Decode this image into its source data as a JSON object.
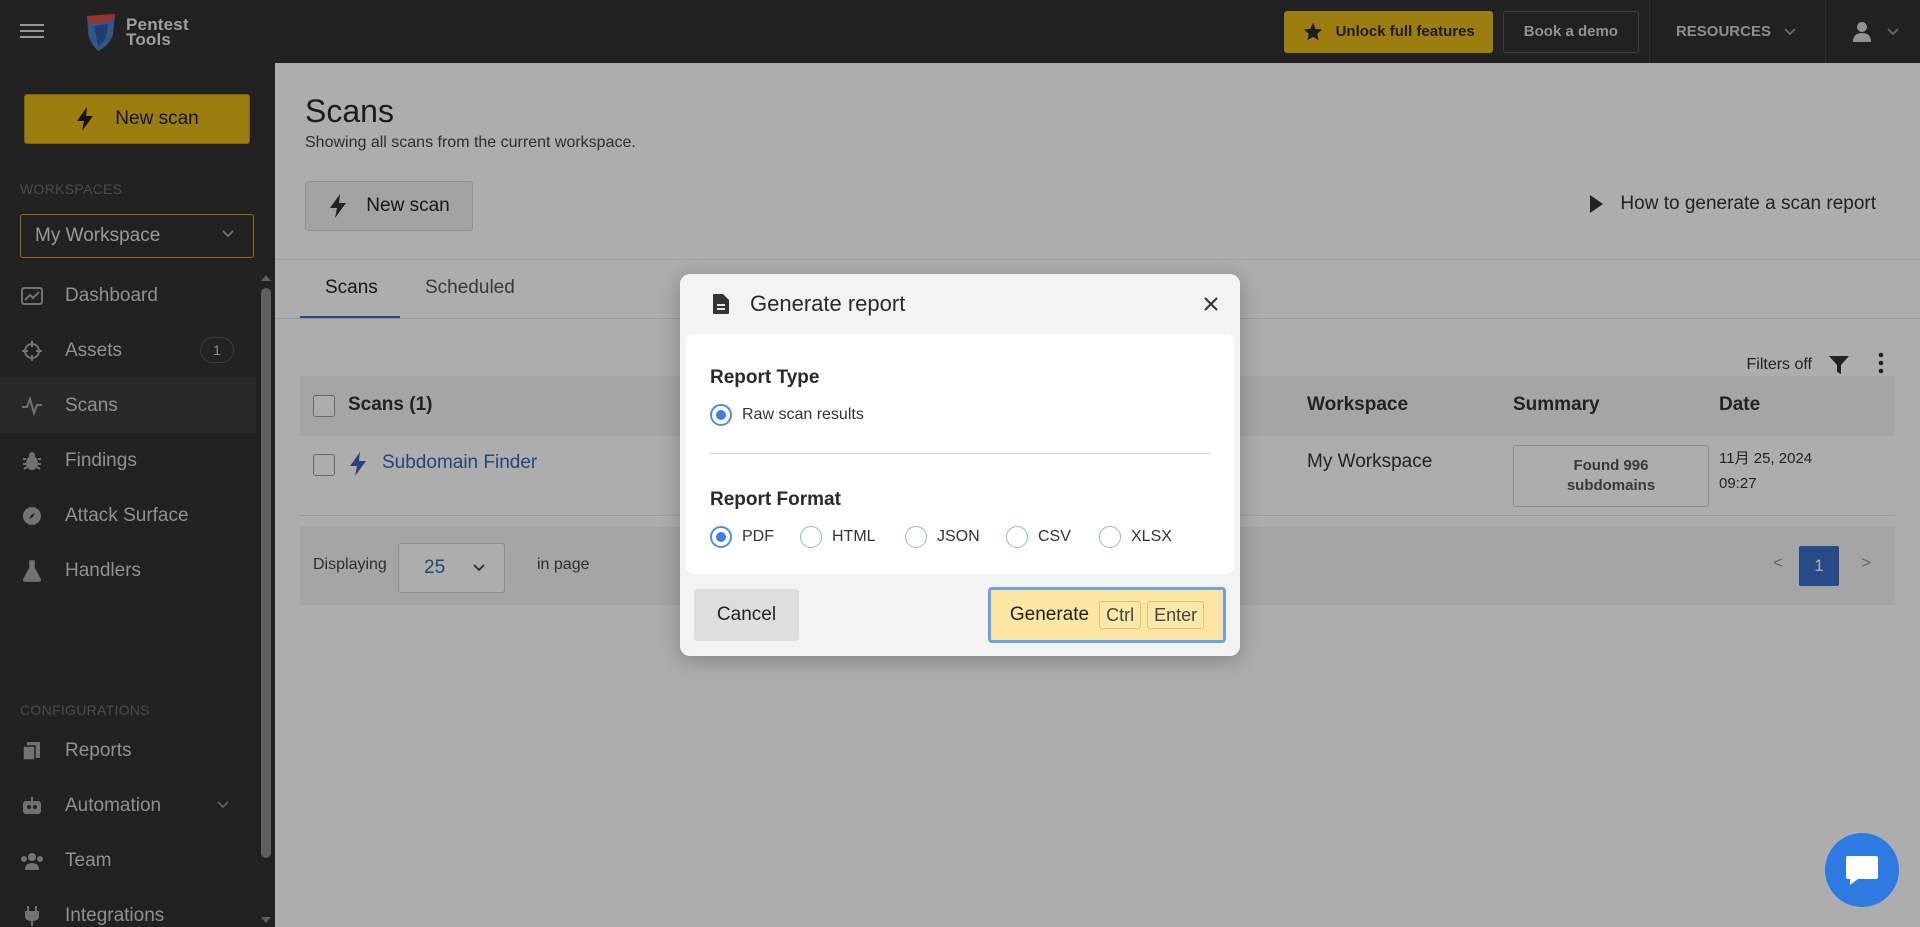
{
  "topbar": {
    "logo_line1": "Pentest",
    "logo_line2": "Tools",
    "unlock_label": "Unlock full features",
    "demo_label": "Book a demo",
    "resources_label": "RESOURCES"
  },
  "sidebar": {
    "new_scan_label": "New scan",
    "workspaces_section": "WORKSPACES",
    "workspace_selected": "My Workspace",
    "items": [
      {
        "label": "Dashboard",
        "icon": "dashboard-icon"
      },
      {
        "label": "Assets",
        "icon": "crosshair-icon",
        "badge": "1"
      },
      {
        "label": "Scans",
        "icon": "pulse-icon"
      },
      {
        "label": "Findings",
        "icon": "bug-icon"
      },
      {
        "label": "Attack Surface",
        "icon": "compass-icon"
      },
      {
        "label": "Handlers",
        "icon": "flask-icon"
      }
    ],
    "configurations_section": "CONFIGURATIONS",
    "config_items": [
      {
        "label": "Reports",
        "icon": "reports-icon"
      },
      {
        "label": "Automation",
        "icon": "robot-icon"
      },
      {
        "label": "Team",
        "icon": "team-icon"
      },
      {
        "label": "Integrations",
        "icon": "plug-icon"
      }
    ]
  },
  "main": {
    "title": "Scans",
    "subtitle": "Showing all scans from the current workspace.",
    "new_scan_label": "New scan",
    "howto_label": "How to generate a scan report",
    "tabs": [
      {
        "label": "Scans"
      },
      {
        "label": "Scheduled"
      }
    ],
    "filters_label": "Filters off",
    "table": {
      "headers": {
        "scans": "Scans (1)",
        "workspace": "Workspace",
        "summary": "Summary",
        "date": "Date"
      },
      "rows": [
        {
          "tool": "Subdomain Finder",
          "workspace": "My Workspace",
          "summary_line1": "Found 996",
          "summary_line2": "subdomains",
          "date_line1": "11月 25, 2024",
          "date_line2": "09:27"
        }
      ]
    },
    "footer": {
      "displaying": "Displaying",
      "per_page": "25",
      "in_page": "in page",
      "current_page": "1",
      "prev": "<",
      "next": ">"
    }
  },
  "modal": {
    "title": "Generate report",
    "report_type_label": "Report Type",
    "report_types": [
      {
        "label": "Raw scan results",
        "checked": true
      }
    ],
    "report_format_label": "Report Format",
    "formats": [
      {
        "label": "PDF",
        "checked": true
      },
      {
        "label": "HTML",
        "checked": false
      },
      {
        "label": "JSON",
        "checked": false
      },
      {
        "label": "CSV",
        "checked": false
      },
      {
        "label": "XLSX",
        "checked": false
      }
    ],
    "cancel_label": "Cancel",
    "generate_label": "Generate",
    "shortcut_ctrl": "Ctrl",
    "shortcut_enter": "Enter"
  },
  "colors": {
    "brand_yellow": "#e5b819",
    "topbar_bg": "#313131",
    "link_blue": "#3a64b5",
    "radio_blue": "#3f7fe0"
  }
}
